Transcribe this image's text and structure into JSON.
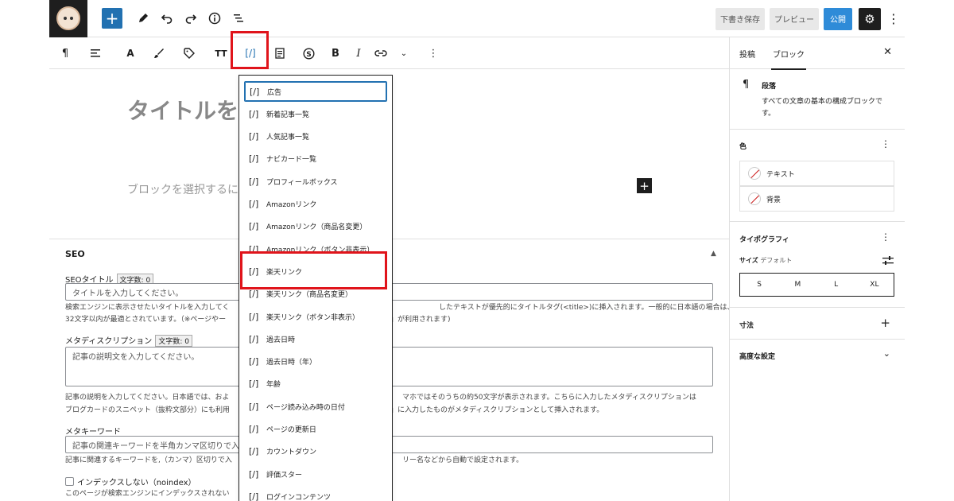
{
  "topbar": {
    "add_label": "+",
    "save_draft": "下書き保存",
    "preview": "プレビュー",
    "publish": "公開",
    "icons": [
      "pen-icon",
      "undo-icon",
      "redo-icon",
      "info-icon",
      "list-view-icon"
    ]
  },
  "editor": {
    "title_placeholder": "タイトルを",
    "block_placeholder": "ブロックを選択するに"
  },
  "dropdown": {
    "icon_glyph": "[/]",
    "items": [
      "広告",
      "新着記事一覧",
      "人気記事一覧",
      "ナビカード一覧",
      "プロフィールボックス",
      "Amazonリンク",
      "Amazonリンク（商品名変更）",
      "Amazonリンク（ボタン非表示）",
      "楽天リンク",
      "楽天リンク（商品名変更）",
      "楽天リンク（ボタン非表示）",
      "過去日時",
      "過去日時（年）",
      "年齢",
      "ページ読み込み時の日付",
      "ページの更新日",
      "カウントダウン",
      "評価スター",
      "ログインコンテンツ"
    ]
  },
  "seo": {
    "heading": "SEO",
    "title_label": "SEOタイトル",
    "title_count": "文字数: 0",
    "title_placeholder": "タイトルを入力してください。",
    "title_help_1a": "検索エンジンに表示させたいタイトルを入力してく",
    "title_help_1b": "したテキストが優先的にタイトルタグ(<title>)に挿入されます。一般的に日本語の場合は、",
    "title_help_2a": "32文字以内が最適とされています。（※ページやー",
    "title_help_2b": "ル」が利用されます)",
    "desc_label": "メタディスクリプション",
    "desc_count": "文字数: 0",
    "desc_placeholder": "記事の説明文を入力してください。",
    "desc_help_1a": "記事の説明を入力してください。日本語では、およ",
    "desc_help_1b": "マホではそのうちの約50文字が表示されます。こちらに入力したメタディスクリプションは",
    "desc_help_2a": "ブログカードのスニペット（抜粋文部分）にも利用",
    "desc_help_2b": "粋」に入力したものがメタディスクリプションとして挿入されます。",
    "kw_label": "メタキーワード",
    "kw_placeholder": "記事の関連キーワードを半角カンマ区切りで入",
    "kw_help_a": "記事に関連するキーワードを,（カンマ）区切りで入",
    "kw_help_b": "リー名などから自動で設定されます。",
    "noindex_label": "インデックスしない（noindex）",
    "noindex_help": "このページが検索エンジンにインデックスされない"
  },
  "sidebar": {
    "tab_post": "投稿",
    "tab_block": "ブロック",
    "close": "✕",
    "block_icon": "¶",
    "block_name": "段落",
    "block_desc_1": "すべての文章の基本の構成ブロックで",
    "block_desc_2": "す。",
    "color_title": "色",
    "color_text": "テキスト",
    "color_bg": "背景",
    "typo_title": "タイポグラフィ",
    "size_label": "サイズ",
    "size_default": "デフォルト",
    "sizes": [
      "S",
      "M",
      "L",
      "XL"
    ],
    "dimensions_title": "寸法",
    "advanced_title": "高度な設定"
  },
  "colors": {
    "accent": "#2271b1",
    "publish": "#2e8bd8",
    "highlight": "#e0141b"
  }
}
